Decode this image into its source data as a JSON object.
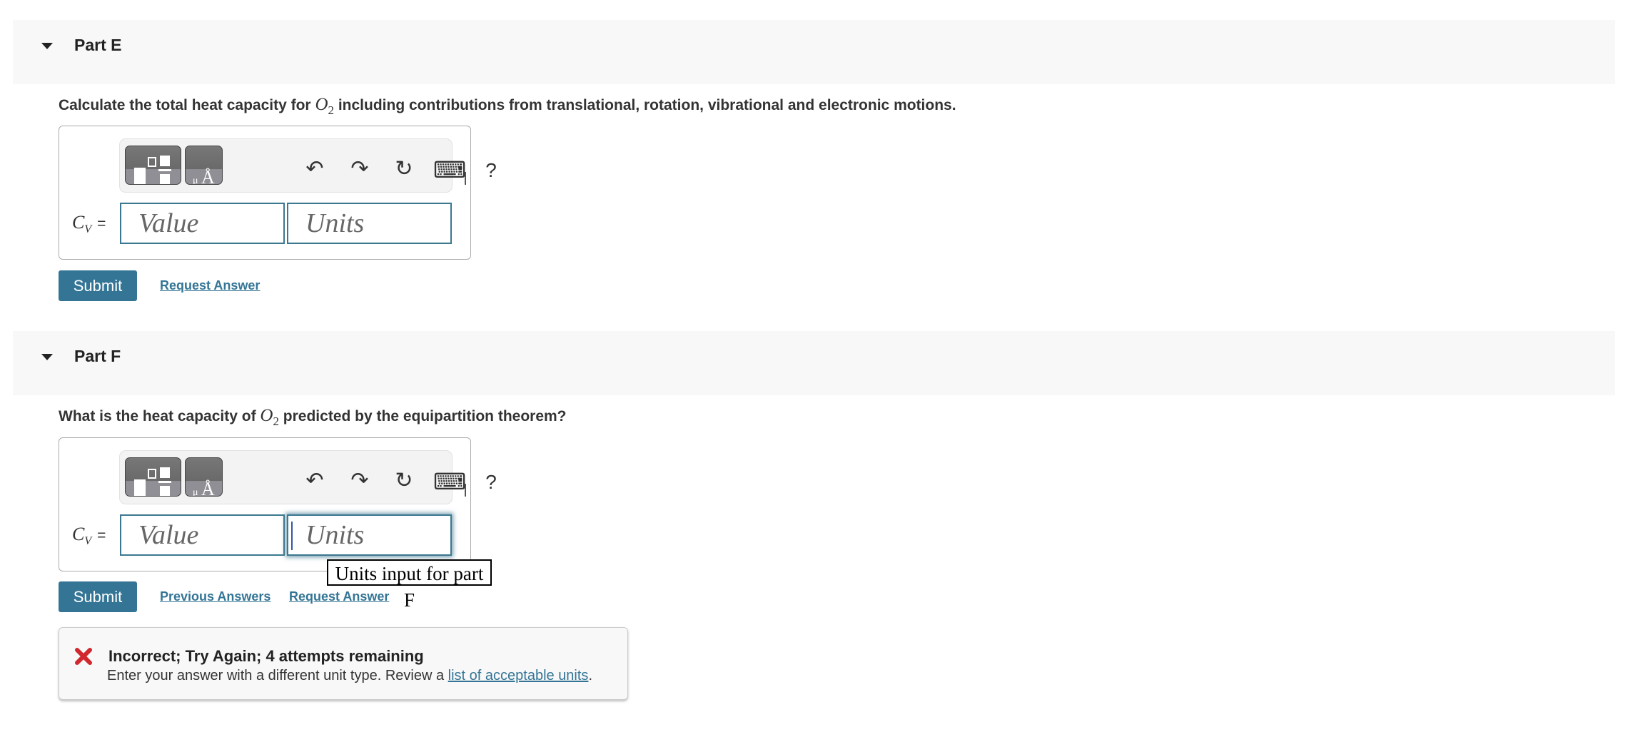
{
  "parts": [
    {
      "title": "Part E",
      "question_before": "Calculate the total heat capacity for ",
      "molecule": "O",
      "molecule_sub": "2",
      "question_after": " including contributions from translational, rotation, vibrational and electronic motions.",
      "answer_label": "C",
      "answer_label_sub": "V",
      "answer_eq": "=",
      "value_placeholder": "Value",
      "units_placeholder": "Units",
      "submit_label": "Submit",
      "request_answer_label": "Request Answer"
    },
    {
      "title": "Part F",
      "question_before": "What is the heat capacity of ",
      "molecule": "O",
      "molecule_sub": "2",
      "question_after": " predicted by the equipartition theorem?",
      "answer_label": "C",
      "answer_label_sub": "V",
      "answer_eq": "=",
      "value_placeholder": "Value",
      "units_placeholder": "Units",
      "submit_label": "Submit",
      "previous_answers_label": "Previous Answers",
      "request_answer_label": "Request Answer",
      "units_tooltip": "Units input for part F",
      "feedback": {
        "icon": "x-mark-icon",
        "title": "Incorrect; Try Again; 4 attempts remaining",
        "message_before": "Enter your answer with a different unit type. Review a ",
        "link_text": "list of acceptable units",
        "message_after": "."
      }
    }
  ],
  "toolbar": {
    "undo": "↶",
    "redo": "↷",
    "reset": "↻",
    "keyboard": "⌨",
    "help": "?"
  },
  "colors": {
    "accent": "#347596",
    "error": "#d0282e",
    "band": "#f8f8f8"
  }
}
